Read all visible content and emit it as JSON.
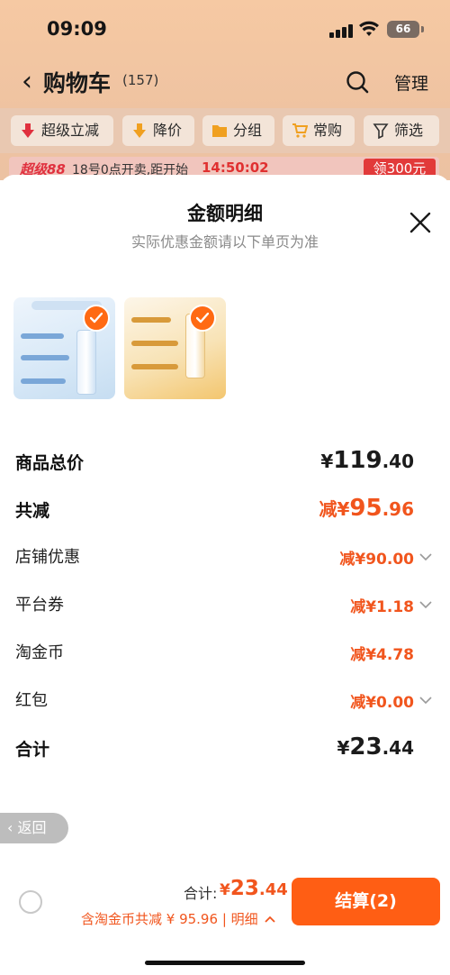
{
  "status_bar": {
    "time": "09:09",
    "battery": "66"
  },
  "header": {
    "title": "购物车",
    "count": "(157)",
    "manage": "管理",
    "icons": [
      "back-chevron-icon",
      "search-icon"
    ]
  },
  "filters": [
    {
      "label": "超级立减",
      "icon": "arrow-down-icon",
      "color": "#e0303e"
    },
    {
      "label": "降价",
      "icon": "down-arrow-icon",
      "color": "#f0a020"
    },
    {
      "label": "分组",
      "icon": "folder-icon",
      "color": "#f0a020"
    },
    {
      "label": "常购",
      "icon": "cart-icon",
      "color": "#f0a020"
    },
    {
      "label": "筛选",
      "icon": "filter-icon",
      "color": "#333333"
    }
  ],
  "promo": {
    "logo": "超级88",
    "text": "18号0点开卖,距开始",
    "timer": "14:50:02",
    "coupon": "领300元"
  },
  "sheet": {
    "title": "金额明细",
    "subtitle": "实际优惠金额请以下单页为准",
    "products": [
      {
        "name": "product-1",
        "tint": "#d7e8f7",
        "selected": true
      },
      {
        "name": "product-2",
        "tint": "#f8e3b6",
        "selected": true
      }
    ],
    "rows": {
      "total_price": {
        "label": "商品总价",
        "currency": "¥",
        "int": "119",
        "dec": ".40"
      },
      "total_discount": {
        "label": "共减",
        "prefix": "减¥",
        "int": "95",
        "dec": ".96"
      },
      "shop_discount": {
        "label": "店铺优惠",
        "value": "减¥90.00"
      },
      "platform_coupon": {
        "label": "平台券",
        "value": "减¥1.18"
      },
      "taobao_coin": {
        "label": "淘金币",
        "value": "减¥4.78"
      },
      "red_packet": {
        "label": "红包",
        "value": "减¥0.00"
      },
      "sum": {
        "label": "合计",
        "currency": "¥",
        "int": "23",
        "dec": ".44"
      }
    }
  },
  "back_pill": {
    "label": "返回"
  },
  "footer": {
    "total_label": "合计:",
    "total_currency": "¥",
    "total_int": "23",
    "total_dec": ".44",
    "coin_note": "含淘金币共减 ¥ 95.96",
    "detail_link": "明细",
    "checkout": "结算(2)"
  },
  "colors": {
    "accent": "#ff5e14",
    "discount": "#f1551d"
  }
}
